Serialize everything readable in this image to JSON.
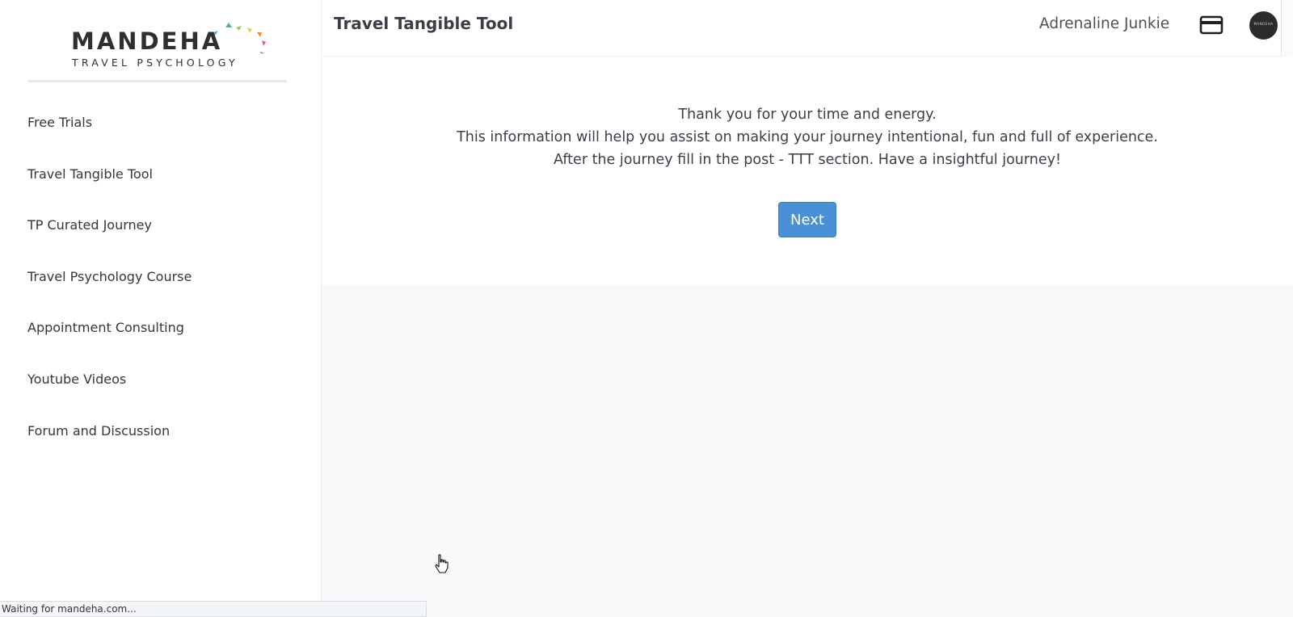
{
  "logo": {
    "title": "MANDEHA",
    "subtitle": "TRAVEL PSYCHOLOGY"
  },
  "sidebar": {
    "items": [
      {
        "label": "Free Trials"
      },
      {
        "label": "Travel Tangible Tool"
      },
      {
        "label": "TP Curated Journey"
      },
      {
        "label": "Travel Psychology Course"
      },
      {
        "label": "Appointment Consulting"
      },
      {
        "label": "Youtube Videos"
      },
      {
        "label": "Forum and Discussion"
      }
    ]
  },
  "header": {
    "title": "Travel Tangible Tool",
    "user_name": "Adrenaline Junkie",
    "card_icon": "credit-card-icon",
    "avatar_text": "MANDEHA"
  },
  "main": {
    "lines": [
      "Thank you for your time and energy.",
      "This information will help you assist on making your journey intentional, fun and full of experience.",
      "After the journey fill in the post - TTT section. Have a insightful journey!"
    ],
    "next_label": "Next"
  },
  "status_bar": {
    "text": "Waiting for mandeha.com..."
  },
  "colors": {
    "accent": "#4a90d6",
    "background": "#f7f8fa",
    "surface": "#ffffff"
  }
}
